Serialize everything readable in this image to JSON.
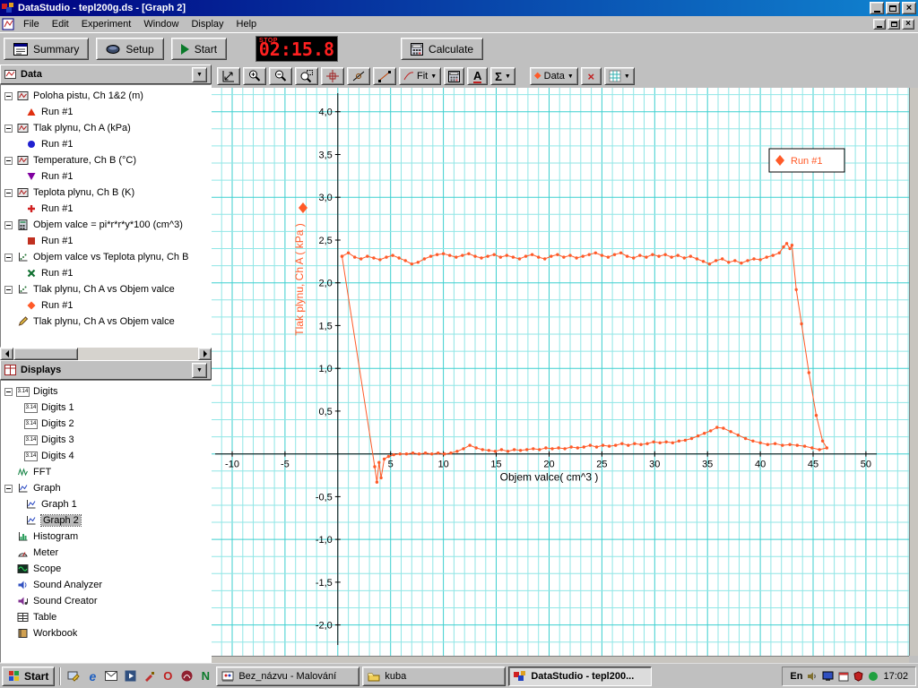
{
  "window": {
    "title": "DataStudio - tepl200g.ds - [Graph 2]"
  },
  "menu": {
    "items": [
      "File",
      "Edit",
      "Experiment",
      "Window",
      "Display",
      "Help"
    ]
  },
  "main_toolbar": {
    "summary_label": "Summary",
    "setup_label": "Setup",
    "start_label": "Start",
    "timer": {
      "stop_label": "STOP",
      "value": "02:15.8"
    },
    "calculate_label": "Calculate"
  },
  "graph_toolbar": {
    "fit_label": "Fit",
    "text_label": "A",
    "sigma_label": "Σ",
    "data_label": "Data"
  },
  "data_panel": {
    "title": "Data",
    "groups": [
      {
        "label": "Poloha pistu, Ch 1&2 (m)",
        "icon": "sensor-icon",
        "run": {
          "label": "Run #1",
          "marker": "triangle-up",
          "color": "#e03010"
        }
      },
      {
        "label": "Tlak plynu, Ch A (kPa)",
        "icon": "sensor-icon",
        "run": {
          "label": "Run #1",
          "marker": "circle",
          "color": "#2020d0"
        }
      },
      {
        "label": "Temperature, Ch B (°C)",
        "icon": "sensor-icon",
        "run": {
          "label": "Run #1",
          "marker": "triangle-down",
          "color": "#8000a0"
        }
      },
      {
        "label": "Teplota plynu, Ch B (K)",
        "icon": "sensor-icon",
        "run": {
          "label": "Run #1",
          "marker": "plus",
          "color": "#d02020"
        }
      },
      {
        "label": "Objem valce = pi*r*r*y*100 (cm^3)",
        "icon": "calculator-icon",
        "run": {
          "label": "Run #1",
          "marker": "square",
          "color": "#c03020"
        }
      },
      {
        "label": "Objem valce vs Teplota plynu, Ch B",
        "icon": "xy-data-icon",
        "run": {
          "label": "Run #1",
          "marker": "x",
          "color": "#107030"
        }
      },
      {
        "label": "Tlak plynu, Ch A vs Objem valce",
        "icon": "xy-data-icon",
        "run": {
          "label": "Run #1",
          "marker": "diamond",
          "color": "#ff5a28"
        }
      },
      {
        "label": "Tlak plynu, Ch A vs Objem valce",
        "icon": "pencil-icon",
        "run": null
      }
    ]
  },
  "displays_panel": {
    "title": "Displays",
    "items": [
      {
        "label": "Digits",
        "icon": "digits-icon",
        "children": [
          {
            "label": "Digits 1",
            "icon": "digits-icon"
          },
          {
            "label": "Digits 2",
            "icon": "digits-icon"
          },
          {
            "label": "Digits 3",
            "icon": "digits-icon"
          },
          {
            "label": "Digits 4",
            "icon": "digits-icon"
          }
        ]
      },
      {
        "label": "FFT",
        "icon": "fft-icon"
      },
      {
        "label": "Graph",
        "icon": "graph-icon",
        "children": [
          {
            "label": "Graph 1",
            "icon": "graph-icon"
          },
          {
            "label": "Graph 2",
            "icon": "graph-icon",
            "selected": true
          }
        ]
      },
      {
        "label": "Histogram",
        "icon": "histogram-icon"
      },
      {
        "label": "Meter",
        "icon": "meter-icon"
      },
      {
        "label": "Scope",
        "icon": "scope-icon"
      },
      {
        "label": "Sound Analyzer",
        "icon": "sound-analyzer-icon"
      },
      {
        "label": "Sound Creator",
        "icon": "sound-creator-icon"
      },
      {
        "label": "Table",
        "icon": "table-icon"
      },
      {
        "label": "Workbook",
        "icon": "workbook-icon"
      }
    ]
  },
  "chart_data": {
    "type": "scatter",
    "xlabel": "Objem valce( cm^3 )",
    "ylabel": "Tlak plynu, Ch A ( kPa )",
    "xlim": [
      -11.95,
      54.08
    ],
    "ylim": [
      -2.36,
      4.28
    ],
    "grid": {
      "on": true,
      "minor_x": 1,
      "minor_y": 0.2,
      "major_x": 5,
      "major_y": 1
    },
    "colors": {
      "grid_minor": "#90e6e6",
      "grid_major": "#3ccfcf",
      "axis": "#000000"
    },
    "x_ticks": [
      {
        "v": -10,
        "label": "-10"
      },
      {
        "v": -5,
        "label": "-5"
      },
      {
        "v": 5,
        "label": "5"
      },
      {
        "v": 10,
        "label": "10"
      },
      {
        "v": 15,
        "label": "15"
      },
      {
        "v": 20,
        "label": "20"
      },
      {
        "v": 25,
        "label": "25"
      },
      {
        "v": 30,
        "label": "30"
      },
      {
        "v": 35,
        "label": "35"
      },
      {
        "v": 40,
        "label": "40"
      },
      {
        "v": 45,
        "label": "45"
      },
      {
        "v": 50,
        "label": "50"
      }
    ],
    "y_ticks": [
      {
        "v": 4,
        "label": "4,0"
      },
      {
        "v": 3.5,
        "label": "3,5"
      },
      {
        "v": 3,
        "label": "3,0"
      },
      {
        "v": 2.5,
        "label": "2,5"
      },
      {
        "v": 2,
        "label": "2,0"
      },
      {
        "v": 1.5,
        "label": "1,5"
      },
      {
        "v": 1,
        "label": "1,0"
      },
      {
        "v": 0.5,
        "label": "0,5"
      },
      {
        "v": -0.5,
        "label": "-0,5"
      },
      {
        "v": -1,
        "label": "-1,0"
      },
      {
        "v": -1.5,
        "label": "-1,5"
      },
      {
        "v": -2,
        "label": "-2,0"
      }
    ],
    "legend": {
      "label": "Run #1",
      "position": "top-right"
    },
    "series": [
      {
        "name": "Run #1",
        "color": "#ff5a28",
        "marker": "diamond",
        "points": [
          [
            0.4,
            2.31
          ],
          [
            1.0,
            2.35
          ],
          [
            1.6,
            2.3
          ],
          [
            2.2,
            2.28
          ],
          [
            2.8,
            2.31
          ],
          [
            3.4,
            2.29
          ],
          [
            4.0,
            2.27
          ],
          [
            4.6,
            2.3
          ],
          [
            5.2,
            2.32
          ],
          [
            5.8,
            2.29
          ],
          [
            6.4,
            2.26
          ],
          [
            7.0,
            2.22
          ],
          [
            7.6,
            2.24
          ],
          [
            8.2,
            2.28
          ],
          [
            8.8,
            2.31
          ],
          [
            9.4,
            2.33
          ],
          [
            10.0,
            2.34
          ],
          [
            10.6,
            2.32
          ],
          [
            11.2,
            2.3
          ],
          [
            11.8,
            2.32
          ],
          [
            12.4,
            2.34
          ],
          [
            13.0,
            2.31
          ],
          [
            13.6,
            2.29
          ],
          [
            14.2,
            2.31
          ],
          [
            14.8,
            2.33
          ],
          [
            15.4,
            2.3
          ],
          [
            16.0,
            2.32
          ],
          [
            16.6,
            2.3
          ],
          [
            17.2,
            2.28
          ],
          [
            17.8,
            2.31
          ],
          [
            18.4,
            2.33
          ],
          [
            19.0,
            2.3
          ],
          [
            19.6,
            2.28
          ],
          [
            20.2,
            2.31
          ],
          [
            20.8,
            2.33
          ],
          [
            21.4,
            2.3
          ],
          [
            22.0,
            2.32
          ],
          [
            22.6,
            2.29
          ],
          [
            23.2,
            2.31
          ],
          [
            23.8,
            2.33
          ],
          [
            24.4,
            2.35
          ],
          [
            25.0,
            2.32
          ],
          [
            25.6,
            2.3
          ],
          [
            26.2,
            2.33
          ],
          [
            26.8,
            2.35
          ],
          [
            27.4,
            2.31
          ],
          [
            28.0,
            2.29
          ],
          [
            28.6,
            2.32
          ],
          [
            29.2,
            2.3
          ],
          [
            29.8,
            2.33
          ],
          [
            30.4,
            2.31
          ],
          [
            31.0,
            2.33
          ],
          [
            31.6,
            2.3
          ],
          [
            32.2,
            2.32
          ],
          [
            32.8,
            2.29
          ],
          [
            33.4,
            2.31
          ],
          [
            34.0,
            2.28
          ],
          [
            34.6,
            2.25
          ],
          [
            35.2,
            2.22
          ],
          [
            35.8,
            2.26
          ],
          [
            36.4,
            2.28
          ],
          [
            37.0,
            2.24
          ],
          [
            37.6,
            2.26
          ],
          [
            38.2,
            2.23
          ],
          [
            38.8,
            2.26
          ],
          [
            39.4,
            2.28
          ],
          [
            40.0,
            2.27
          ],
          [
            40.6,
            2.3
          ],
          [
            41.2,
            2.32
          ],
          [
            41.8,
            2.35
          ],
          [
            42.2,
            2.42
          ],
          [
            42.5,
            2.46
          ],
          [
            42.8,
            2.4
          ],
          [
            43.0,
            2.44
          ],
          [
            43.4,
            1.92
          ],
          [
            43.9,
            1.52
          ],
          [
            44.6,
            0.95
          ],
          [
            45.3,
            0.45
          ],
          [
            45.9,
            0.15
          ],
          [
            46.3,
            0.07
          ],
          [
            45.6,
            0.05
          ],
          [
            44.9,
            0.07
          ],
          [
            44.2,
            0.09
          ],
          [
            43.5,
            0.1
          ],
          [
            42.8,
            0.11
          ],
          [
            42.1,
            0.1
          ],
          [
            41.4,
            0.12
          ],
          [
            40.7,
            0.11
          ],
          [
            40.0,
            0.13
          ],
          [
            39.3,
            0.15
          ],
          [
            38.6,
            0.18
          ],
          [
            37.9,
            0.22
          ],
          [
            37.2,
            0.26
          ],
          [
            36.5,
            0.3
          ],
          [
            35.9,
            0.31
          ],
          [
            35.3,
            0.27
          ],
          [
            34.7,
            0.24
          ],
          [
            34.1,
            0.21
          ],
          [
            33.5,
            0.18
          ],
          [
            32.9,
            0.16
          ],
          [
            32.3,
            0.15
          ],
          [
            31.7,
            0.13
          ],
          [
            31.1,
            0.14
          ],
          [
            30.5,
            0.13
          ],
          [
            29.9,
            0.14
          ],
          [
            29.3,
            0.12
          ],
          [
            28.7,
            0.11
          ],
          [
            28.1,
            0.12
          ],
          [
            27.5,
            0.1
          ],
          [
            26.9,
            0.12
          ],
          [
            26.3,
            0.1
          ],
          [
            25.7,
            0.09
          ],
          [
            25.1,
            0.1
          ],
          [
            24.5,
            0.08
          ],
          [
            23.9,
            0.1
          ],
          [
            23.3,
            0.08
          ],
          [
            22.7,
            0.07
          ],
          [
            22.1,
            0.08
          ],
          [
            21.5,
            0.06
          ],
          [
            20.9,
            0.07
          ],
          [
            20.3,
            0.06
          ],
          [
            19.7,
            0.07
          ],
          [
            19.1,
            0.05
          ],
          [
            18.5,
            0.06
          ],
          [
            17.9,
            0.05
          ],
          [
            17.3,
            0.04
          ],
          [
            16.7,
            0.05
          ],
          [
            16.1,
            0.03
          ],
          [
            15.5,
            0.05
          ],
          [
            14.9,
            0.03
          ],
          [
            14.3,
            0.04
          ],
          [
            13.7,
            0.05
          ],
          [
            13.1,
            0.07
          ],
          [
            12.5,
            0.1
          ],
          [
            11.9,
            0.06
          ],
          [
            11.3,
            0.03
          ],
          [
            10.7,
            0.01
          ],
          [
            10.1,
            0.0
          ],
          [
            9.5,
            0.01
          ],
          [
            8.9,
            0.0
          ],
          [
            8.3,
            0.01
          ],
          [
            7.7,
            0.0
          ],
          [
            7.1,
            0.01
          ],
          [
            6.5,
            0.0
          ],
          [
            5.9,
            0.0
          ],
          [
            5.3,
            -0.01
          ],
          [
            4.8,
            -0.03
          ],
          [
            4.4,
            -0.06
          ],
          [
            4.1,
            -0.28
          ],
          [
            3.9,
            -0.1
          ],
          [
            3.7,
            -0.33
          ],
          [
            3.5,
            -0.15
          ],
          [
            0.4,
            2.31
          ]
        ]
      }
    ]
  },
  "taskbar": {
    "start_label": "Start",
    "tasks": [
      {
        "label": "Bez_názvu - Malování",
        "icon": "paint-icon",
        "active": false
      },
      {
        "label": "kuba",
        "icon": "folder-icon",
        "active": false
      },
      {
        "label": "DataStudio - tepl200...",
        "icon": "datastudio-icon",
        "active": true
      }
    ],
    "tray": {
      "lang": "En",
      "clock": "17:02"
    }
  }
}
